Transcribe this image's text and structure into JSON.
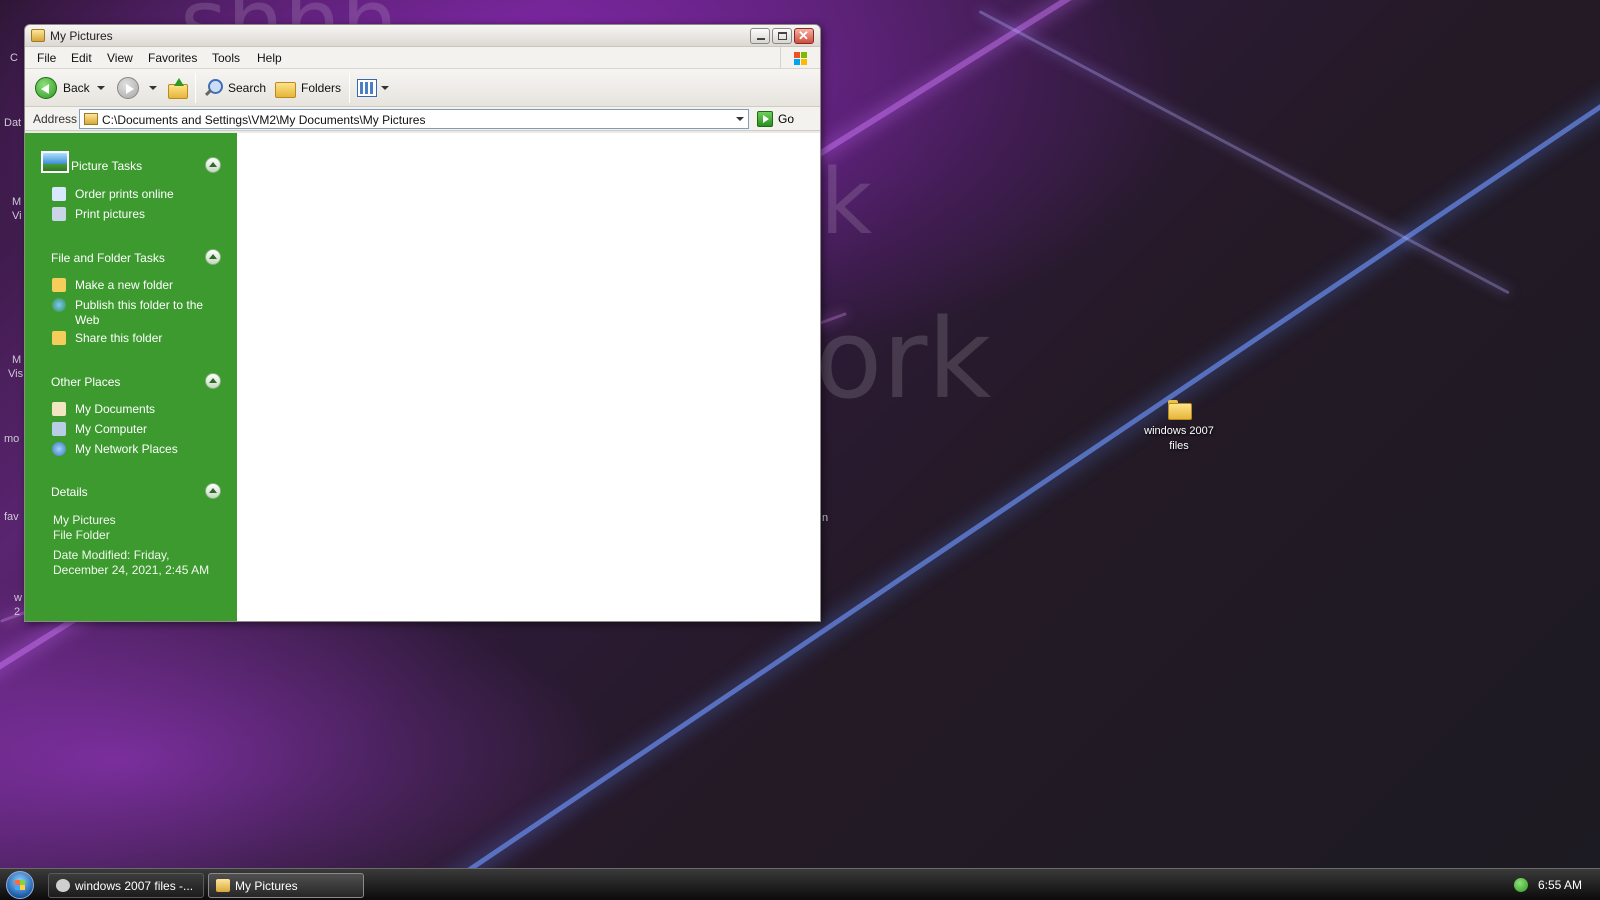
{
  "window": {
    "title": "My Pictures",
    "menu": [
      "File",
      "Edit",
      "View",
      "Favorites",
      "Tools",
      "Help"
    ],
    "toolbar": {
      "back_label": "Back",
      "search_label": "Search",
      "folders_label": "Folders"
    },
    "address": {
      "label": "Address",
      "value": "C:\\Documents and Settings\\VM2\\My Documents\\My Pictures",
      "go_label": "Go"
    },
    "taskpane": {
      "picture_tasks": {
        "title": "Picture Tasks",
        "items": [
          "Order prints online",
          "Print pictures"
        ]
      },
      "file_folder_tasks": {
        "title": "File and Folder Tasks",
        "items": [
          "Make a new folder",
          "Publish this folder to the Web",
          "Share this folder"
        ]
      },
      "other_places": {
        "title": "Other Places",
        "items": [
          "My Documents",
          "My Computer",
          "My Network Places"
        ]
      },
      "details": {
        "title": "Details",
        "name": "My Pictures",
        "type": "File Folder",
        "modified": "Date Modified: Friday, December 24, 2021, 2:45 AM"
      }
    }
  },
  "desktop": {
    "folder_icon_label": "windows 2007 files",
    "icon": "folder-icon"
  },
  "taskbar": {
    "buttons": [
      "windows 2007 files -...",
      "My Pictures"
    ],
    "active_button": "My Pictures",
    "clock": "6:55 AM"
  },
  "colors": {
    "taskpane_green": "#3c9a2f",
    "taskbar": "#1a1a1a"
  }
}
